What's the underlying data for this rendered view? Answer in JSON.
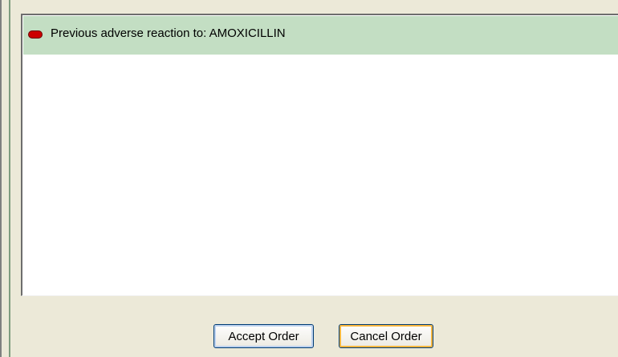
{
  "alert": {
    "icon": "red-pill-alert-icon",
    "text": "Previous adverse reaction to: AMOXICILLIN"
  },
  "actions": {
    "accept_label": "Accept Order",
    "cancel_label": "Cancel Order"
  },
  "colors": {
    "row_highlight": "#c3dec3",
    "dialog_background": "#ece9d8",
    "alert_icon": "#cc0000"
  }
}
